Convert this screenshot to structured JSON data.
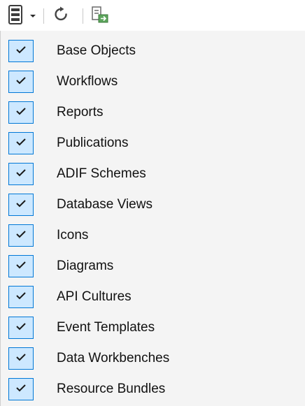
{
  "toolbar": {
    "buttons": [
      {
        "icon": "object-store-icon",
        "has_dropdown": true
      },
      {
        "icon": "refresh-icon"
      },
      {
        "icon": "export-icon"
      }
    ]
  },
  "menu": {
    "items": [
      {
        "label": "Base Objects",
        "checked": true
      },
      {
        "label": "Workflows",
        "checked": true
      },
      {
        "label": "Reports",
        "checked": true
      },
      {
        "label": "Publications",
        "checked": true
      },
      {
        "label": "ADIF Schemes",
        "checked": true
      },
      {
        "label": "Database Views",
        "checked": true
      },
      {
        "label": "Icons",
        "checked": true
      },
      {
        "label": "Diagrams",
        "checked": true
      },
      {
        "label": "API Cultures",
        "checked": true
      },
      {
        "label": "Event Templates",
        "checked": true
      },
      {
        "label": "Data Workbenches",
        "checked": true
      },
      {
        "label": "Resource Bundles",
        "checked": true
      }
    ]
  },
  "colors": {
    "check_fill": "#cde8ff",
    "check_border": "#0078d7",
    "check_mark": "#1a1a1a",
    "menu_background": "#f4f4f4"
  }
}
